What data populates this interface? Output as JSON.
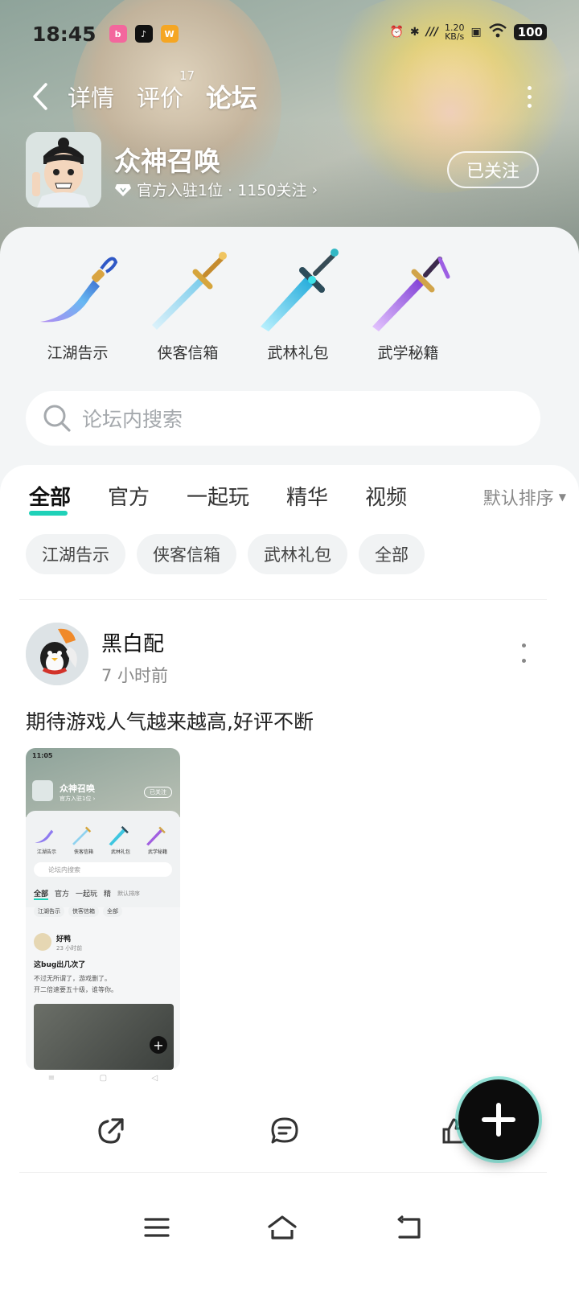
{
  "status_bar": {
    "time": "18:45",
    "app_icons": [
      "bilibili-icon",
      "tiktok-icon",
      "weibo-icon"
    ],
    "net_speed": "1.20",
    "net_unit": "KB/s",
    "battery": "100"
  },
  "nav": {
    "tabs": [
      {
        "label": "详情"
      },
      {
        "label": "评价",
        "badge": "17"
      },
      {
        "label": "论坛"
      }
    ],
    "active_tab": "论坛"
  },
  "game": {
    "name": "众神召唤",
    "meta": "官方入驻1位 · 1150关注",
    "follow_label": "已关注"
  },
  "categories": [
    {
      "label": "江湖告示",
      "color": "#8f7bf0"
    },
    {
      "label": "侠客信箱",
      "color": "#8fd2ef"
    },
    {
      "label": "武林礼包",
      "color": "#3ec6e0"
    },
    {
      "label": "武学秘籍",
      "color": "#a15fe0"
    }
  ],
  "search": {
    "placeholder": "论坛内搜索"
  },
  "feed_tabs": [
    "全部",
    "官方",
    "一起玩",
    "精华",
    "视频"
  ],
  "sort_label": "默认排序",
  "chips": [
    "江湖告示",
    "侠客信箱",
    "武林礼包",
    "全部"
  ],
  "post": {
    "user": "黑白配",
    "time": "7 小时前",
    "text": "期待游戏人气越来越高,好评不断",
    "screenshot": {
      "time": "11:05",
      "title": "众神召唤",
      "meta": "官方入驻1位 ›",
      "follow": "已关注",
      "weapon_labels": [
        "江湖告示",
        "侠客信箱",
        "武林礼包",
        "武学秘籍"
      ],
      "search": "论坛内搜索",
      "tabs": [
        "全部",
        "官方",
        "一起玩",
        "精"
      ],
      "sort": "默认排序",
      "chips": [
        "江湖告示",
        "侠客信箱",
        "全部"
      ],
      "post_user": "好鸭",
      "post_time": "23 小时前",
      "post_title": "这bug出几次了",
      "post_line1": "不过无所谓了，游戏删了。",
      "post_line2": "开二倍速要五十级，谁等你。"
    }
  },
  "accent_color": "#1fd1b8"
}
